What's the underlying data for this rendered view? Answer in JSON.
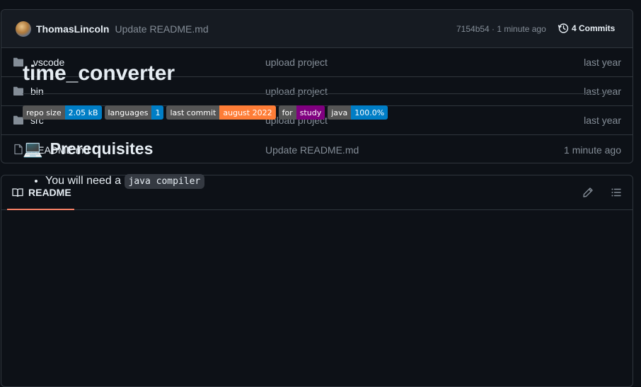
{
  "commit_bar": {
    "author": "ThomasLincoln",
    "message": "Update README.md",
    "meta": "7154b54 · 1 minute ago",
    "commits_label": "4 Commits"
  },
  "files": [
    {
      "name": ".vscode",
      "type": "folder",
      "commit": "upload project",
      "date": "last year"
    },
    {
      "name": "bin",
      "type": "folder",
      "commit": "upload project",
      "date": "last year"
    },
    {
      "name": "src",
      "type": "folder",
      "commit": "upload project",
      "date": "last year"
    },
    {
      "name": "README.md",
      "type": "file",
      "commit": "Update README.md",
      "date": "1 minute ago"
    }
  ],
  "readme": {
    "tab_label": "README",
    "title": "time_converter",
    "badges": [
      {
        "label": "repo size",
        "value": "2.05 kB",
        "color": "#007ec6"
      },
      {
        "label": "languages",
        "value": "1",
        "color": "#007ec6"
      },
      {
        "label": "last commit",
        "value": "august 2022",
        "color": "#fe7d37"
      },
      {
        "label": "for",
        "value": "study",
        "color": "#800080"
      },
      {
        "label": "java",
        "value": "100.0%",
        "color": "#007ec6"
      }
    ],
    "prereq_emoji": "💻",
    "prereq_heading": "Prerequisites",
    "prereq_text": "You will need a ",
    "prereq_code": "java compiler"
  },
  "icons": {
    "folder": "folder-icon",
    "file": "file-icon",
    "history": "history-icon",
    "book": "book-icon",
    "pencil": "pencil-icon",
    "outline": "list-unordered-icon"
  },
  "colors": {
    "background": "#0d1117",
    "border": "#30363d",
    "muted_text": "#848d97",
    "tab_underline": "#f78166",
    "folder_icon": "#848d97"
  }
}
